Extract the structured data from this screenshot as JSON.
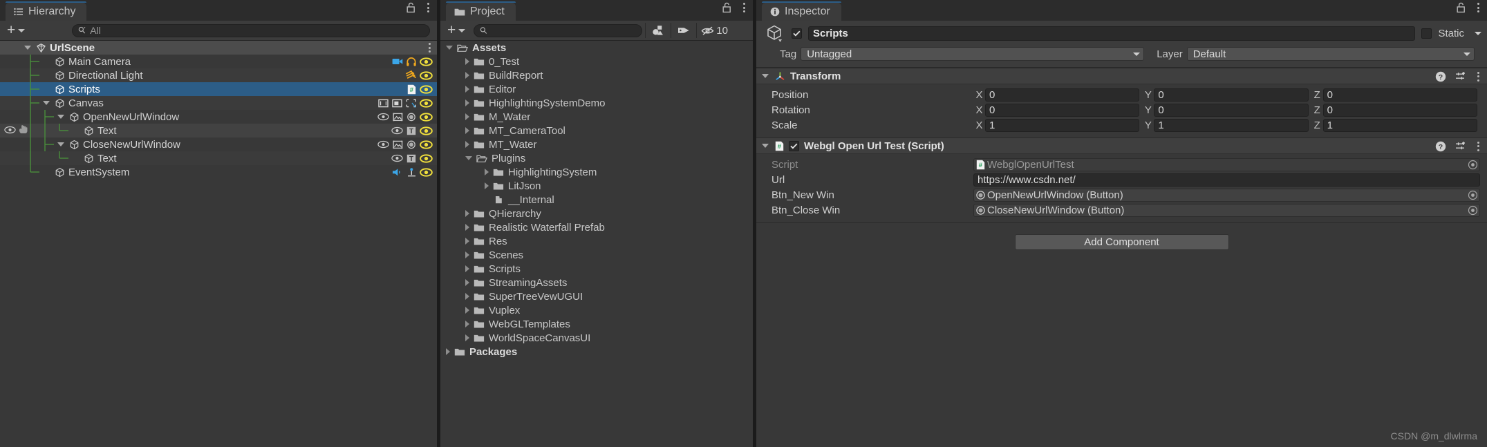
{
  "hierarchy": {
    "tab_label": "Hierarchy",
    "tab_icon": "list-icon",
    "lock_icon": "lock-open-icon",
    "menu_icon": "kebab-menu-icon",
    "add_label": "+",
    "search_placeholder": "All",
    "search_value": "",
    "rows": [
      {
        "label": "UrlScene",
        "depth": 0,
        "type": "scene",
        "expanded": true,
        "selected": false,
        "hovered": false,
        "icons": [],
        "row_menu": true
      },
      {
        "label": "Main Camera",
        "depth": 1,
        "type": "object",
        "expanded": null,
        "selected": false,
        "hovered": false,
        "icons": [
          "camera-icon",
          "audio-listener-icon",
          "eye-icon"
        ],
        "row_menu": false
      },
      {
        "label": "Directional Light",
        "depth": 1,
        "type": "object",
        "expanded": null,
        "selected": false,
        "hovered": false,
        "icons": [
          "light-icon",
          "eye-icon"
        ],
        "row_menu": false
      },
      {
        "label": "Scripts",
        "depth": 1,
        "type": "object",
        "expanded": null,
        "selected": true,
        "hovered": false,
        "icons": [
          "csharp-script-icon",
          "eye-icon"
        ],
        "row_menu": false
      },
      {
        "label": "Canvas",
        "depth": 1,
        "type": "object",
        "expanded": true,
        "selected": false,
        "hovered": false,
        "icons": [
          "canvas-icon",
          "canvas-scaler-icon",
          "graphic-raycaster-icon",
          "eye-icon"
        ],
        "row_menu": false
      },
      {
        "label": "OpenNewUrlWindow",
        "depth": 2,
        "type": "object",
        "expanded": true,
        "selected": false,
        "hovered": false,
        "icons": [
          "eye-outline-icon",
          "image-icon",
          "button-icon",
          "eye-icon"
        ],
        "row_menu": false
      },
      {
        "label": "Text",
        "depth": 3,
        "type": "object",
        "expanded": null,
        "selected": false,
        "hovered": true,
        "icons": [
          "eye-outline-icon",
          "text-icon",
          "eye-icon"
        ],
        "row_menu": false,
        "gutter_icons": [
          "eye-icon",
          "hand-icon"
        ]
      },
      {
        "label": "CloseNewUrlWindow",
        "depth": 2,
        "type": "object",
        "expanded": true,
        "selected": false,
        "hovered": false,
        "icons": [
          "eye-outline-icon",
          "image-icon",
          "button-icon",
          "eye-icon"
        ],
        "row_menu": false
      },
      {
        "label": "Text",
        "depth": 3,
        "type": "object",
        "expanded": null,
        "selected": false,
        "hovered": false,
        "icons": [
          "eye-outline-icon",
          "text-icon",
          "eye-icon"
        ],
        "row_menu": false
      },
      {
        "label": "EventSystem",
        "depth": 1,
        "type": "object",
        "expanded": null,
        "selected": false,
        "hovered": false,
        "icons": [
          "event-system-icon",
          "input-module-icon",
          "eye-icon"
        ],
        "row_menu": false
      }
    ]
  },
  "project": {
    "tab_label": "Project",
    "tab_icon": "folder-icon",
    "lock_icon": "lock-open-icon",
    "menu_icon": "kebab-menu-icon",
    "add_label": "+",
    "search_placeholder": "",
    "search_value": "",
    "toolbar_icons": [
      "object-filter-icon",
      "label-filter-icon",
      "hidden-packages-icon"
    ],
    "hidden_count": "10",
    "rows": [
      {
        "label": "Assets",
        "depth": 0,
        "state": "open",
        "bold": true,
        "icon": "folder-open-icon"
      },
      {
        "label": "0_Test",
        "depth": 1,
        "state": "closed",
        "bold": false,
        "icon": "folder-icon"
      },
      {
        "label": "BuildReport",
        "depth": 1,
        "state": "closed",
        "bold": false,
        "icon": "folder-icon"
      },
      {
        "label": "Editor",
        "depth": 1,
        "state": "closed",
        "bold": false,
        "icon": "folder-icon"
      },
      {
        "label": "HighlightingSystemDemo",
        "depth": 1,
        "state": "closed",
        "bold": false,
        "icon": "folder-icon"
      },
      {
        "label": "M_Water",
        "depth": 1,
        "state": "closed",
        "bold": false,
        "icon": "folder-icon"
      },
      {
        "label": "MT_CameraTool",
        "depth": 1,
        "state": "closed",
        "bold": false,
        "icon": "folder-icon"
      },
      {
        "label": "MT_Water",
        "depth": 1,
        "state": "closed",
        "bold": false,
        "icon": "folder-icon"
      },
      {
        "label": "Plugins",
        "depth": 1,
        "state": "open",
        "bold": false,
        "icon": "folder-open-icon"
      },
      {
        "label": "HighlightingSystem",
        "depth": 2,
        "state": "closed",
        "bold": false,
        "icon": "folder-icon"
      },
      {
        "label": "LitJson",
        "depth": 2,
        "state": "closed",
        "bold": false,
        "icon": "folder-icon"
      },
      {
        "label": "__Internal",
        "depth": 2,
        "state": "leaf",
        "bold": false,
        "icon": "plugin-icon"
      },
      {
        "label": "QHierarchy",
        "depth": 1,
        "state": "closed",
        "bold": false,
        "icon": "folder-icon"
      },
      {
        "label": "Realistic Waterfall Prefab",
        "depth": 1,
        "state": "closed",
        "bold": false,
        "icon": "folder-icon"
      },
      {
        "label": "Res",
        "depth": 1,
        "state": "closed",
        "bold": false,
        "icon": "folder-icon"
      },
      {
        "label": "Scenes",
        "depth": 1,
        "state": "closed",
        "bold": false,
        "icon": "folder-icon"
      },
      {
        "label": "Scripts",
        "depth": 1,
        "state": "closed",
        "bold": false,
        "icon": "folder-icon"
      },
      {
        "label": "StreamingAssets",
        "depth": 1,
        "state": "closed",
        "bold": false,
        "icon": "folder-icon"
      },
      {
        "label": "SuperTreeVewUGUI",
        "depth": 1,
        "state": "closed",
        "bold": false,
        "icon": "folder-icon"
      },
      {
        "label": "Vuplex",
        "depth": 1,
        "state": "closed",
        "bold": false,
        "icon": "folder-icon"
      },
      {
        "label": "WebGLTemplates",
        "depth": 1,
        "state": "closed",
        "bold": false,
        "icon": "folder-icon"
      },
      {
        "label": "WorldSpaceCanvasUI",
        "depth": 1,
        "state": "closed",
        "bold": false,
        "icon": "folder-icon"
      },
      {
        "label": "Packages",
        "depth": 0,
        "state": "closed",
        "bold": true,
        "icon": "folder-icon"
      }
    ]
  },
  "inspector": {
    "tab_label": "Inspector",
    "tab_icon": "info-icon",
    "lock_icon": "lock-open-icon",
    "menu_icon": "kebab-menu-icon",
    "gameobject": {
      "icon": "gameobject-cube-icon",
      "enabled": true,
      "name": "Scripts",
      "static_label": "Static",
      "static_checked": false,
      "tag_label": "Tag",
      "tag_value": "Untagged",
      "layer_label": "Layer",
      "layer_value": "Default"
    },
    "components": [
      {
        "title": "Transform",
        "icon": "transform-axis-icon",
        "expanded": true,
        "has_enable_checkbox": false,
        "enabled": true,
        "vector_rows": [
          {
            "label": "Position",
            "axes": [
              "X",
              "Y",
              "Z"
            ],
            "values": [
              "0",
              "0",
              "0"
            ]
          },
          {
            "label": "Rotation",
            "axes": [
              "X",
              "Y",
              "Z"
            ],
            "values": [
              "0",
              "0",
              "0"
            ]
          },
          {
            "label": "Scale",
            "axes": [
              "X",
              "Y",
              "Z"
            ],
            "values": [
              "1",
              "1",
              "1"
            ]
          }
        ],
        "object_rows": []
      },
      {
        "title": "Webgl Open Url Test (Script)",
        "icon": "csharp-script-icon",
        "expanded": true,
        "has_enable_checkbox": true,
        "enabled": true,
        "vector_rows": [],
        "object_rows": [
          {
            "label": "Script",
            "value": "WebglOpenUrlTest",
            "field_kind": "object",
            "field_icon": "csharp-script-icon",
            "dimmed": true,
            "picker": true
          },
          {
            "label": "Url",
            "value": "https://www.csdn.net/",
            "field_kind": "text",
            "field_icon": "",
            "dimmed": false,
            "picker": false
          },
          {
            "label": "Btn_New Win",
            "value": "OpenNewUrlWindow (Button)",
            "field_kind": "object",
            "field_icon": "dot-target-icon",
            "dimmed": false,
            "picker": true
          },
          {
            "label": "Btn_Close Win",
            "value": "CloseNewUrlWindow (Button)",
            "field_kind": "object",
            "field_icon": "dot-target-icon",
            "dimmed": false,
            "picker": true
          }
        ]
      }
    ],
    "add_component_label": "Add Component",
    "help_icon": "help-icon",
    "preset_icon": "preset-icon",
    "menu_icon_comp": "kebab-menu-icon"
  },
  "watermark": "CSDN @m_dlwlrma",
  "colors": {
    "panel_bg": "#383838",
    "panel_header": "#3c3c3c",
    "tab_bg": "#3b3b3b",
    "tabstrip_bg": "#2c2c2c",
    "selection_blue": "#2c5d87",
    "scene_row": "#4c4c4c",
    "text_primary": "#d2d2d2",
    "text_dim": "#8d8d8d",
    "field_bg": "#2a2a2a",
    "tree_line_green": "#4a8f3c",
    "eye_yellow": "#f2e13c",
    "button_bg": "#585858",
    "window_bg": "#1b1b1b"
  }
}
